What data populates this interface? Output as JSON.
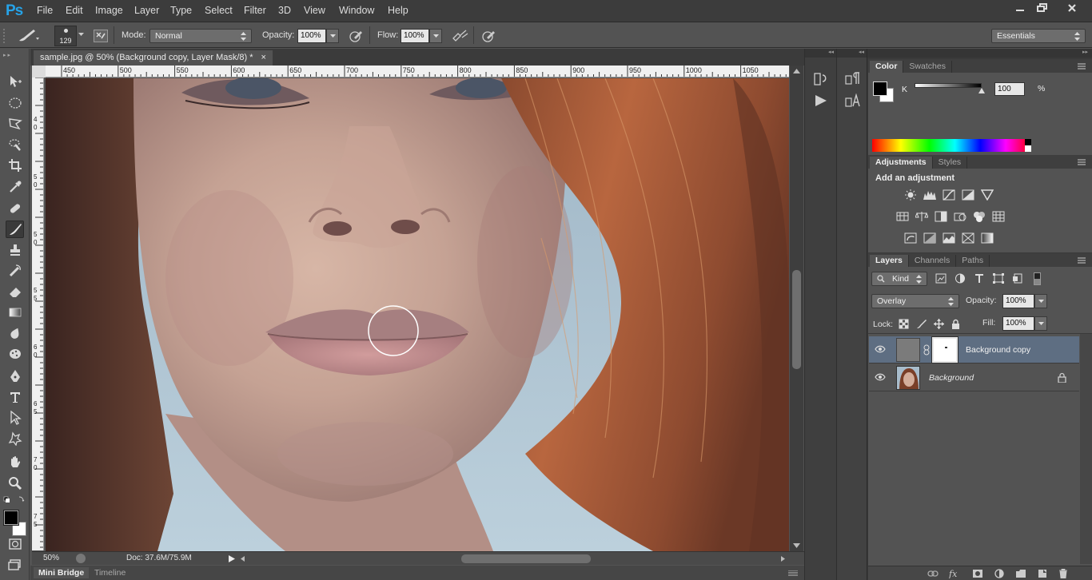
{
  "app": {
    "logo": "Ps"
  },
  "menu": [
    "File",
    "Edit",
    "Image",
    "Layer",
    "Type",
    "Select",
    "Filter",
    "3D",
    "View",
    "Window",
    "Help"
  ],
  "options": {
    "brush_size": "129",
    "mode_label": "Mode:",
    "mode_value": "Normal",
    "opacity_label": "Opacity:",
    "opacity_value": "100%",
    "flow_label": "Flow:",
    "flow_value": "100%",
    "workspace": "Essentials"
  },
  "document": {
    "tab_title": "sample.jpg @ 50% (Background copy, Layer Mask/8) *",
    "close_glyph": "×",
    "ruler_top": [
      "450",
      "500",
      "550",
      "600",
      "650",
      "700",
      "750",
      "800",
      "850",
      "900",
      "950",
      "1000",
      "1050"
    ],
    "ruler_left": [
      "4",
      "0",
      "5",
      "0",
      "5",
      "0",
      "5",
      "5",
      "6",
      "0",
      "6",
      "5",
      "7",
      "0",
      "7",
      "5",
      "8",
      "0"
    ]
  },
  "status": {
    "zoom": "50%",
    "doc_info": "Doc: 37.6M/75.9M"
  },
  "bottom_tabs": [
    "Mini Bridge",
    "Timeline"
  ],
  "color_panel": {
    "tabs": [
      "Color",
      "Swatches"
    ],
    "channel_label": "K",
    "channel_value": "100",
    "unit": "%",
    "foreground": "#000000",
    "background": "#ffffff"
  },
  "adjustments_panel": {
    "tabs": [
      "Adjustments",
      "Styles"
    ],
    "heading": "Add an adjustment"
  },
  "layers_panel": {
    "tabs": [
      "Layers",
      "Channels",
      "Paths"
    ],
    "filter_kind": "Kind",
    "blend_mode": "Overlay",
    "opacity_label": "Opacity:",
    "opacity_value": "100%",
    "lock_label": "Lock:",
    "fill_label": "Fill:",
    "fill_value": "100%",
    "layers": [
      {
        "name": "Background copy",
        "selected": true
      },
      {
        "name": "Background",
        "selected": false
      }
    ]
  },
  "colors": {
    "accent": "#26a3e8",
    "ui_dark": "#3c3c3c",
    "ui_mid": "#535353",
    "selected_layer": "#5e6e82"
  }
}
